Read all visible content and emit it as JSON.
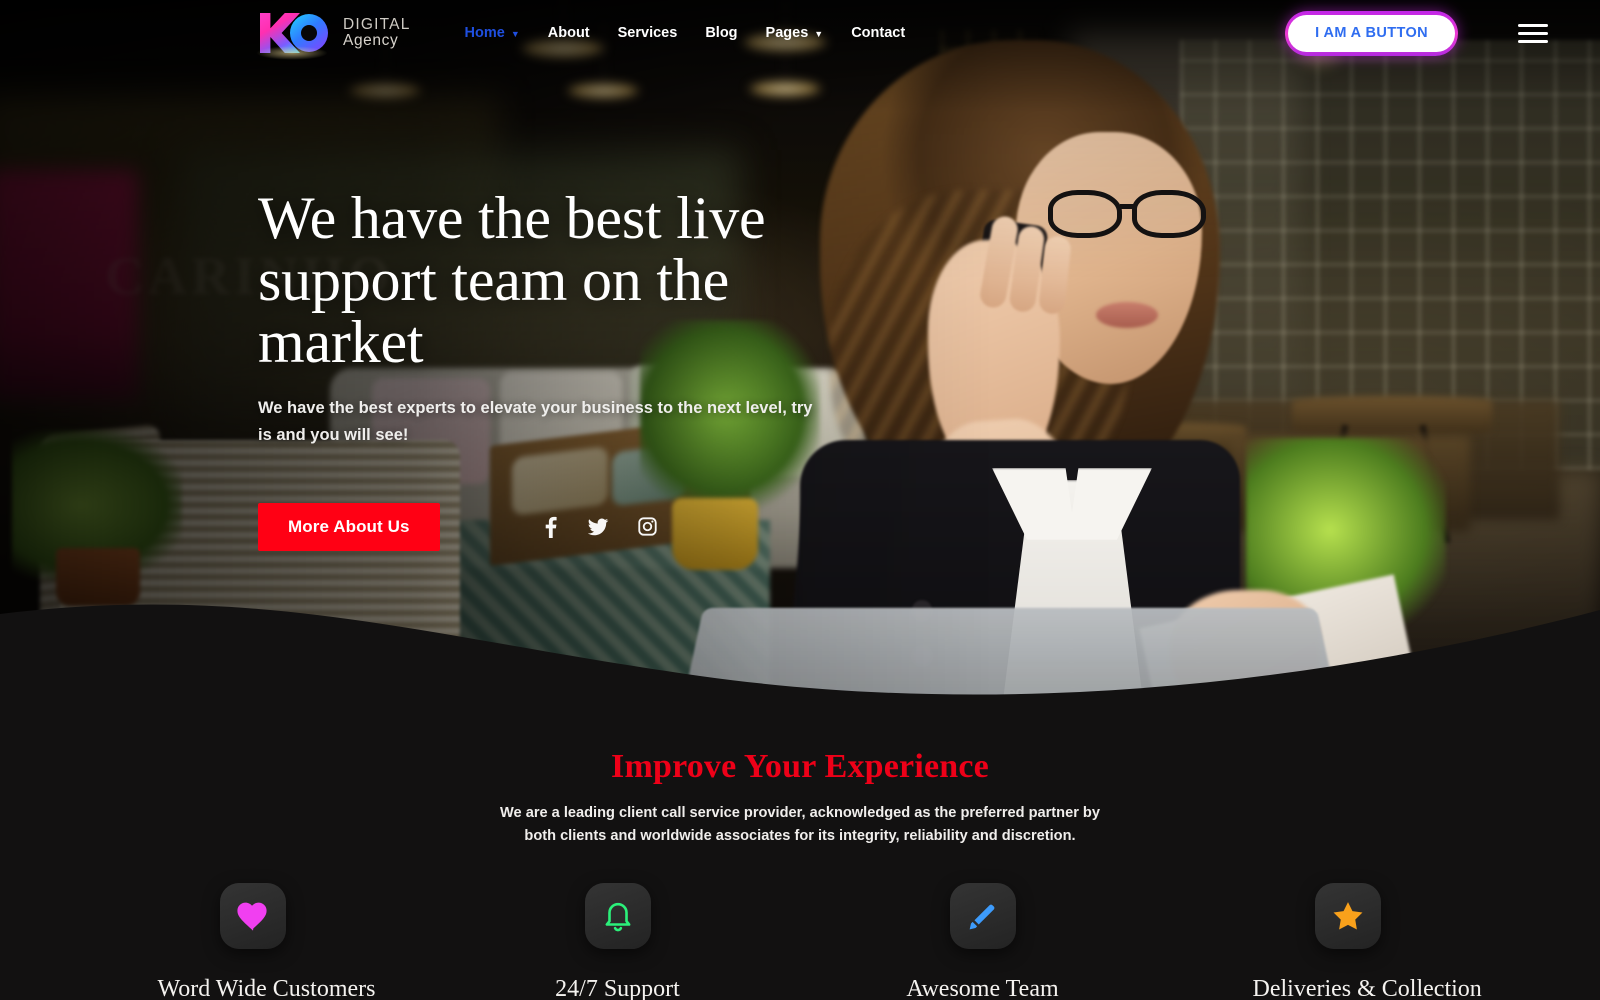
{
  "brand": {
    "mark_letters": "KC",
    "line1": "DIGITAL",
    "line2": "Agency"
  },
  "nav": {
    "items": [
      {
        "label": "Home",
        "active": true,
        "has_caret": true,
        "icon": "home-icon"
      },
      {
        "label": "About",
        "active": false,
        "has_caret": false
      },
      {
        "label": "Services",
        "active": false,
        "has_caret": false
      },
      {
        "label": "Blog",
        "active": false,
        "has_caret": false
      },
      {
        "label": "Pages",
        "active": false,
        "has_caret": true
      },
      {
        "label": "Contact",
        "active": false,
        "has_caret": false
      }
    ],
    "cta_label": "I AM A BUTTON",
    "menu_icon": "hamburger-menu-icon"
  },
  "hero": {
    "title": "We have the best live support team on the market",
    "subtitle": "We have the best experts to elevate your business to the next level, try is and you will see!",
    "button_label": "More About Us",
    "socials": [
      {
        "name": "facebook-icon",
        "label": "Facebook"
      },
      {
        "name": "twitter-icon",
        "label": "Twitter"
      },
      {
        "name": "instagram-icon",
        "label": "Instagram"
      }
    ]
  },
  "features": {
    "title": "Improve Your Experience",
    "description": "We are a leading client call service provider, acknowledged as the preferred partner by both clients and worldwide associates for its integrity, reliability and discretion.",
    "items": [
      {
        "icon": "heart-icon",
        "label": "Word Wide Customers",
        "color": "#f13ff1"
      },
      {
        "icon": "bell-icon",
        "label": "24/7 Support",
        "color": "#2bf07a"
      },
      {
        "icon": "pencil-icon",
        "label": "Awesome Team",
        "color": "#3d9bfb"
      },
      {
        "icon": "star-icon",
        "label": "Deliveries & Collection",
        "color": "#f9a11b"
      }
    ]
  },
  "colors": {
    "accent_red": "#ff0014",
    "heading_red": "#ee0018",
    "nav_active_blue": "#1f4fe0",
    "cta_text_blue": "#2f6df0",
    "cta_border_magenta": "#c026e8",
    "section_bg": "#121111"
  }
}
